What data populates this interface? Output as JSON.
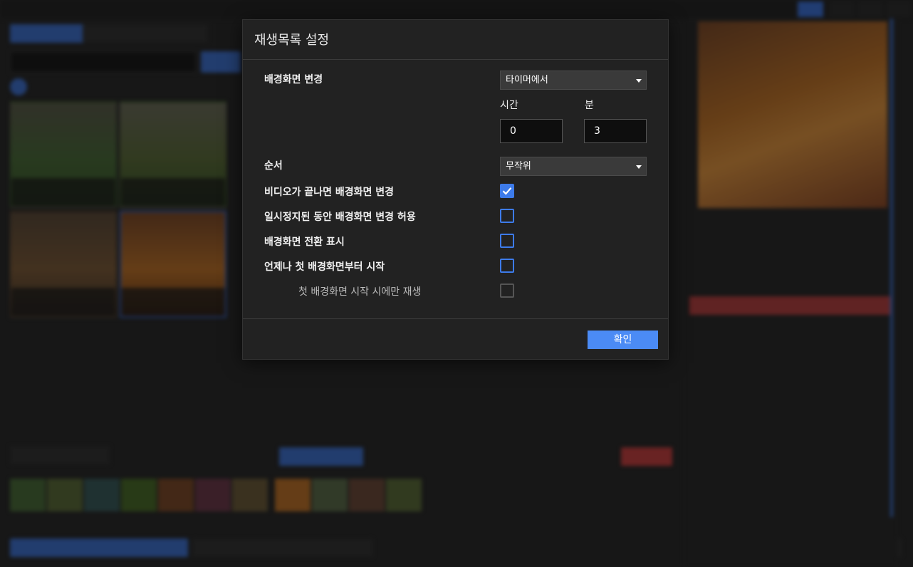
{
  "dialog": {
    "title": "재생목록 설정",
    "change_wallpaper": {
      "label": "배경화면 변경",
      "mode_value": "타이머에서",
      "hours_label": "시간",
      "minutes_label": "분",
      "hours_value": "0",
      "minutes_value": "3"
    },
    "order": {
      "label": "순서",
      "value": "무작위"
    },
    "options": [
      {
        "label": "비디오가 끝나면 배경화면 변경",
        "checked": true
      },
      {
        "label": "일시정지된 동안 배경화면 변경 허용",
        "checked": false
      },
      {
        "label": "배경화면 전환 표시",
        "checked": false
      },
      {
        "label": "언제나 첫 배경화면부터 시작",
        "checked": false
      }
    ],
    "sub_option": {
      "label": "첫 배경화면 시작 시에만 재생",
      "checked": false,
      "disabled": true
    },
    "ok_label": "확인"
  },
  "colors": {
    "accent": "#4b8bf5",
    "checkbox": "#3d7bea",
    "dialog_bg": "#222222"
  }
}
